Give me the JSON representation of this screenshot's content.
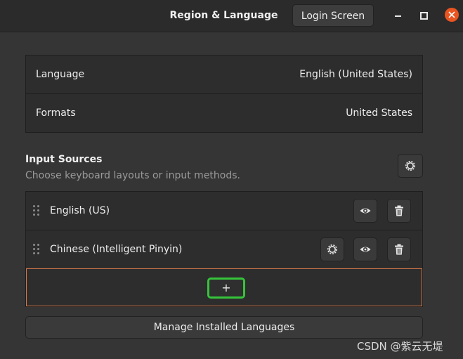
{
  "window": {
    "title": "Region & Language",
    "login_screen_label": "Login Screen"
  },
  "language_settings": {
    "rows": [
      {
        "label": "Language",
        "value": "English (United States)"
      },
      {
        "label": "Formats",
        "value": "United States"
      }
    ]
  },
  "input_sources": {
    "heading": "Input Sources",
    "subtitle": "Choose keyboard layouts or input methods.",
    "items": [
      {
        "label": "English (US)",
        "has_settings": false
      },
      {
        "label": "Chinese (Intelligent Pinyin)",
        "has_settings": true
      }
    ],
    "add_label": "+"
  },
  "manage_label": "Manage Installed Languages",
  "watermark": "CSDN @紫云无堤",
  "colors": {
    "close_button": "#e95420",
    "add_row_border": "#d77a4a",
    "add_button_highlight": "#35c43a"
  },
  "icons": [
    "minimize-icon",
    "maximize-icon",
    "close-icon",
    "gear-icon",
    "eye-icon",
    "trash-icon",
    "drag-handle-icon",
    "plus-icon"
  ]
}
